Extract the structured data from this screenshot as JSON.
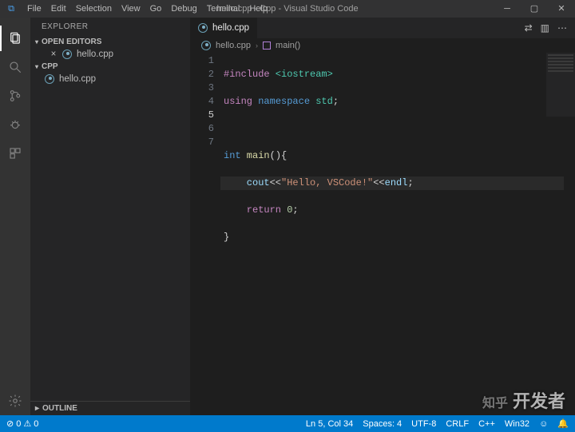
{
  "title_bar": {
    "menu": [
      "File",
      "Edit",
      "Selection",
      "View",
      "Go",
      "Debug",
      "Terminal",
      "Help"
    ],
    "title": "hello.cpp - Cpp - Visual Studio Code"
  },
  "sidebar": {
    "header": "EXPLORER",
    "open_editors_label": "OPEN EDITORS",
    "open_editors": [
      {
        "name": "hello.cpp"
      }
    ],
    "workspace_label": "CPP",
    "files": [
      {
        "name": "hello.cpp"
      }
    ],
    "outline_label": "OUTLINE"
  },
  "editor": {
    "tab": {
      "name": "hello.cpp"
    },
    "breadcrumb": {
      "file": "hello.cpp",
      "symbol": "main()"
    },
    "line_numbers": [
      "1",
      "2",
      "3",
      "4",
      "5",
      "6",
      "7"
    ],
    "current_line": 5,
    "code": {
      "l1": {
        "a": "#include",
        "b": " <iostream>"
      },
      "l2": {
        "a": "using",
        "b": " namespace",
        "c": " std",
        "d": ";"
      },
      "l4": {
        "a": "int",
        "b": " main",
        "c": "()",
        "d": "{"
      },
      "l5": {
        "a": "    cout",
        "b": "<<",
        "c": "\"Hello, VSCode!\"",
        "d": "<<",
        "e": "endl",
        "f": ";"
      },
      "l6": {
        "a": "    return",
        "b": " 0",
        "c": ";"
      },
      "l7": "}"
    }
  },
  "status": {
    "errors": "0",
    "warnings": "0",
    "ln_col": "Ln 5, Col 34",
    "spaces": "Spaces: 4",
    "encoding": "UTF-8",
    "eol": "CRLF",
    "lang": "C++",
    "right": "Win32",
    "right2": "☺",
    "right3": "🔔"
  },
  "watermark": {
    "zhihu": "知乎",
    "brand": "开发者"
  }
}
